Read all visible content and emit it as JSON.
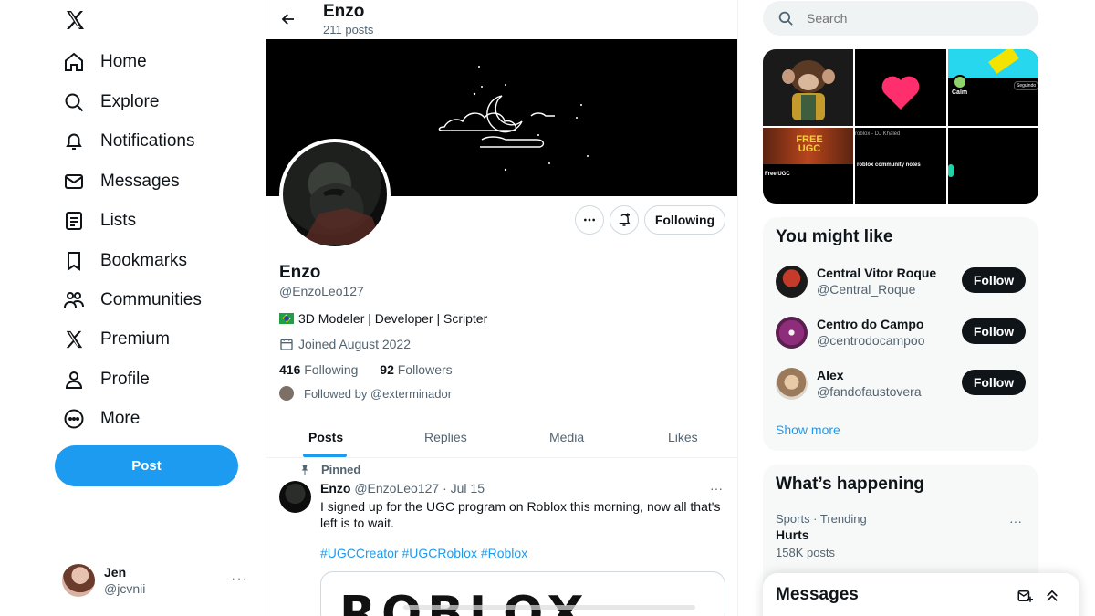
{
  "nav": {
    "logo": "X",
    "items": [
      {
        "label": "Home",
        "icon": "home-icon"
      },
      {
        "label": "Explore",
        "icon": "search-icon"
      },
      {
        "label": "Notifications",
        "icon": "bell-icon"
      },
      {
        "label": "Messages",
        "icon": "envelope-icon"
      },
      {
        "label": "Lists",
        "icon": "list-icon"
      },
      {
        "label": "Bookmarks",
        "icon": "bookmark-icon"
      },
      {
        "label": "Communities",
        "icon": "communities-icon"
      },
      {
        "label": "Premium",
        "icon": "x-logo-icon"
      },
      {
        "label": "Profile",
        "icon": "person-icon"
      },
      {
        "label": "More",
        "icon": "more-circle-icon"
      }
    ],
    "post_label": "Post",
    "account": {
      "name": "Jen",
      "handle": "@jcvnii",
      "more": "···"
    }
  },
  "profile": {
    "header_name": "Enzo",
    "post_count": "211 posts",
    "name": "Enzo",
    "handle": "@EnzoLeo127",
    "bio": "3D Modeler | Developer | Scripter",
    "joined": "Joined August 2022",
    "following_count": "416",
    "following_label": "Following",
    "followers_count": "92",
    "followers_label": "Followers",
    "followed_by": "Followed by @exterminador",
    "following_button": "Following"
  },
  "tabs": [
    "Posts",
    "Replies",
    "Media",
    "Likes"
  ],
  "pinned_post": {
    "pinned_label": "Pinned",
    "author": "Enzo",
    "meta": "@EnzoLeo127 · Jul 15",
    "text": "I signed up for the UGC program on Roblox this morning, now all that's left is to wait.",
    "hashtags": "#UGCCreator #UGCRoblox #Roblox",
    "media_word": "ROBLOX"
  },
  "search": {
    "placeholder": "Search"
  },
  "media_grid": {
    "calm_label": "Calm",
    "free_ugc": "FREE UGC",
    "free_ugc_sub": "Free UGC",
    "dj_khaled": "roblox - DJ Khaled",
    "community_notes": "roblox community notes",
    "seguindo": "Seguindo"
  },
  "suggestions": {
    "title": "You might like",
    "items": [
      {
        "name": "Central Vitor Roque",
        "handle": "@Central_Roque",
        "button": "Follow"
      },
      {
        "name": "Centro do Campo",
        "handle": "@centrodocampoo",
        "button": "Follow"
      },
      {
        "name": "Alex",
        "handle": "@fandofaustovera",
        "button": "Follow"
      }
    ],
    "show_more": "Show more"
  },
  "happening": {
    "title": "What’s happening",
    "trend_meta": "Sports · Trending",
    "trend_name": "Hurts",
    "trend_count": "158K posts"
  },
  "messages_drawer": {
    "title": "Messages"
  },
  "colors": {
    "accent": "#1d9bf0",
    "text": "#0f1419",
    "muted": "#536471"
  }
}
